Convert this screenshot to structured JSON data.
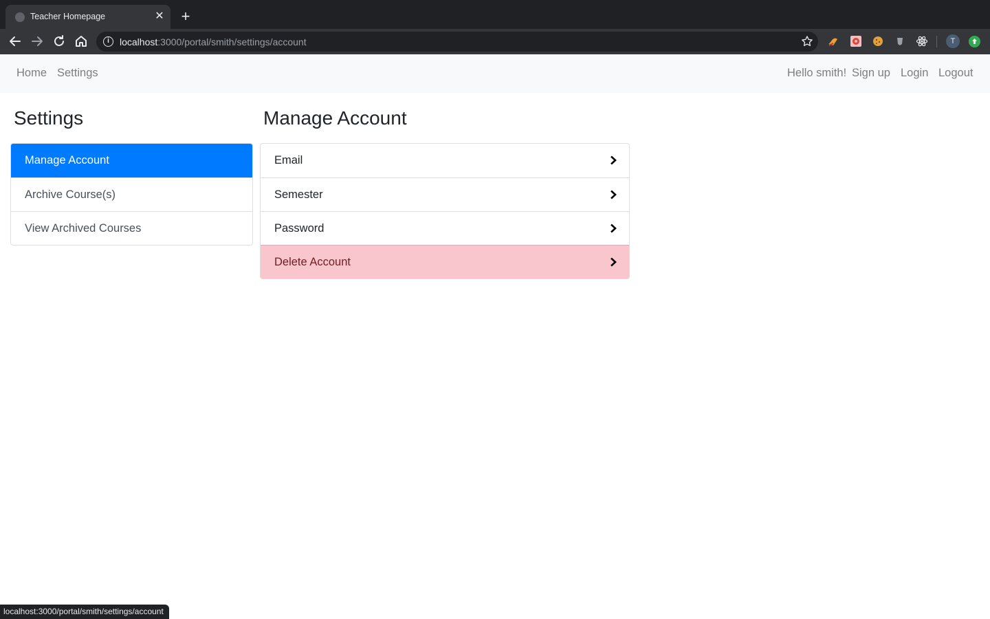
{
  "browser": {
    "tab_title": "Teacher Homepage",
    "url_host": "localhost",
    "url_path": ":3000/portal/smith/settings/account",
    "status_url": "localhost:3000/portal/smith/settings/account",
    "profile_initial": "T"
  },
  "navbar": {
    "left_links": [
      "Home",
      "Settings"
    ],
    "greeting": "Hello smith!",
    "right_links": [
      "Sign up",
      "Login",
      "Logout"
    ]
  },
  "sidebar": {
    "title": "Settings",
    "items": [
      {
        "label": "Manage Account",
        "active": true
      },
      {
        "label": "Archive Course(s)",
        "active": false
      },
      {
        "label": "View Archived Courses",
        "active": false
      }
    ]
  },
  "main": {
    "title": "Manage Account",
    "items": [
      {
        "label": "Email",
        "variant": "default"
      },
      {
        "label": "Semester",
        "variant": "default"
      },
      {
        "label": "Password",
        "variant": "default"
      },
      {
        "label": "Delete Account",
        "variant": "danger"
      }
    ]
  },
  "colors": {
    "active": "#007bff",
    "danger_bg": "#f8c6cc",
    "danger_text": "#721c24"
  }
}
